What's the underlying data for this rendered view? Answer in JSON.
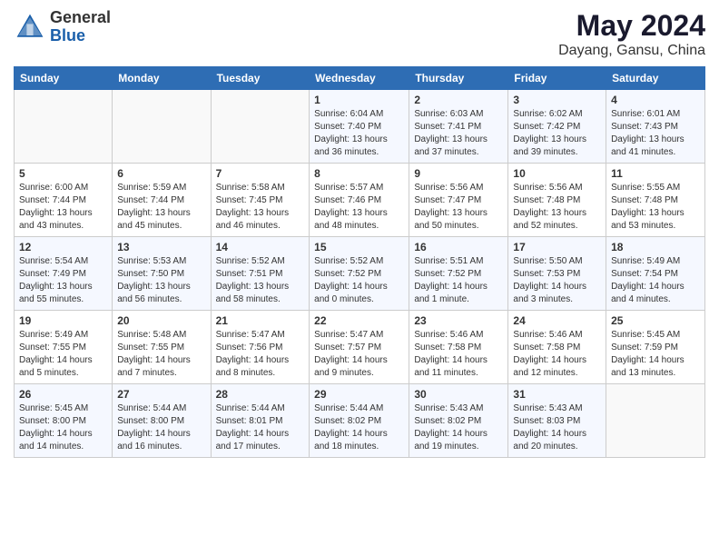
{
  "header": {
    "logo_general": "General",
    "logo_blue": "Blue",
    "title": "May 2024",
    "subtitle": "Dayang, Gansu, China"
  },
  "days_of_week": [
    "Sunday",
    "Monday",
    "Tuesday",
    "Wednesday",
    "Thursday",
    "Friday",
    "Saturday"
  ],
  "weeks": [
    [
      {
        "day": "",
        "info": ""
      },
      {
        "day": "",
        "info": ""
      },
      {
        "day": "",
        "info": ""
      },
      {
        "day": "1",
        "info": "Sunrise: 6:04 AM\nSunset: 7:40 PM\nDaylight: 13 hours and 36 minutes."
      },
      {
        "day": "2",
        "info": "Sunrise: 6:03 AM\nSunset: 7:41 PM\nDaylight: 13 hours and 37 minutes."
      },
      {
        "day": "3",
        "info": "Sunrise: 6:02 AM\nSunset: 7:42 PM\nDaylight: 13 hours and 39 minutes."
      },
      {
        "day": "4",
        "info": "Sunrise: 6:01 AM\nSunset: 7:43 PM\nDaylight: 13 hours and 41 minutes."
      }
    ],
    [
      {
        "day": "5",
        "info": "Sunrise: 6:00 AM\nSunset: 7:44 PM\nDaylight: 13 hours and 43 minutes."
      },
      {
        "day": "6",
        "info": "Sunrise: 5:59 AM\nSunset: 7:44 PM\nDaylight: 13 hours and 45 minutes."
      },
      {
        "day": "7",
        "info": "Sunrise: 5:58 AM\nSunset: 7:45 PM\nDaylight: 13 hours and 46 minutes."
      },
      {
        "day": "8",
        "info": "Sunrise: 5:57 AM\nSunset: 7:46 PM\nDaylight: 13 hours and 48 minutes."
      },
      {
        "day": "9",
        "info": "Sunrise: 5:56 AM\nSunset: 7:47 PM\nDaylight: 13 hours and 50 minutes."
      },
      {
        "day": "10",
        "info": "Sunrise: 5:56 AM\nSunset: 7:48 PM\nDaylight: 13 hours and 52 minutes."
      },
      {
        "day": "11",
        "info": "Sunrise: 5:55 AM\nSunset: 7:48 PM\nDaylight: 13 hours and 53 minutes."
      }
    ],
    [
      {
        "day": "12",
        "info": "Sunrise: 5:54 AM\nSunset: 7:49 PM\nDaylight: 13 hours and 55 minutes."
      },
      {
        "day": "13",
        "info": "Sunrise: 5:53 AM\nSunset: 7:50 PM\nDaylight: 13 hours and 56 minutes."
      },
      {
        "day": "14",
        "info": "Sunrise: 5:52 AM\nSunset: 7:51 PM\nDaylight: 13 hours and 58 minutes."
      },
      {
        "day": "15",
        "info": "Sunrise: 5:52 AM\nSunset: 7:52 PM\nDaylight: 14 hours and 0 minutes."
      },
      {
        "day": "16",
        "info": "Sunrise: 5:51 AM\nSunset: 7:52 PM\nDaylight: 14 hours and 1 minute."
      },
      {
        "day": "17",
        "info": "Sunrise: 5:50 AM\nSunset: 7:53 PM\nDaylight: 14 hours and 3 minutes."
      },
      {
        "day": "18",
        "info": "Sunrise: 5:49 AM\nSunset: 7:54 PM\nDaylight: 14 hours and 4 minutes."
      }
    ],
    [
      {
        "day": "19",
        "info": "Sunrise: 5:49 AM\nSunset: 7:55 PM\nDaylight: 14 hours and 5 minutes."
      },
      {
        "day": "20",
        "info": "Sunrise: 5:48 AM\nSunset: 7:55 PM\nDaylight: 14 hours and 7 minutes."
      },
      {
        "day": "21",
        "info": "Sunrise: 5:47 AM\nSunset: 7:56 PM\nDaylight: 14 hours and 8 minutes."
      },
      {
        "day": "22",
        "info": "Sunrise: 5:47 AM\nSunset: 7:57 PM\nDaylight: 14 hours and 9 minutes."
      },
      {
        "day": "23",
        "info": "Sunrise: 5:46 AM\nSunset: 7:58 PM\nDaylight: 14 hours and 11 minutes."
      },
      {
        "day": "24",
        "info": "Sunrise: 5:46 AM\nSunset: 7:58 PM\nDaylight: 14 hours and 12 minutes."
      },
      {
        "day": "25",
        "info": "Sunrise: 5:45 AM\nSunset: 7:59 PM\nDaylight: 14 hours and 13 minutes."
      }
    ],
    [
      {
        "day": "26",
        "info": "Sunrise: 5:45 AM\nSunset: 8:00 PM\nDaylight: 14 hours and 14 minutes."
      },
      {
        "day": "27",
        "info": "Sunrise: 5:44 AM\nSunset: 8:00 PM\nDaylight: 14 hours and 16 minutes."
      },
      {
        "day": "28",
        "info": "Sunrise: 5:44 AM\nSunset: 8:01 PM\nDaylight: 14 hours and 17 minutes."
      },
      {
        "day": "29",
        "info": "Sunrise: 5:44 AM\nSunset: 8:02 PM\nDaylight: 14 hours and 18 minutes."
      },
      {
        "day": "30",
        "info": "Sunrise: 5:43 AM\nSunset: 8:02 PM\nDaylight: 14 hours and 19 minutes."
      },
      {
        "day": "31",
        "info": "Sunrise: 5:43 AM\nSunset: 8:03 PM\nDaylight: 14 hours and 20 minutes."
      },
      {
        "day": "",
        "info": ""
      }
    ]
  ]
}
